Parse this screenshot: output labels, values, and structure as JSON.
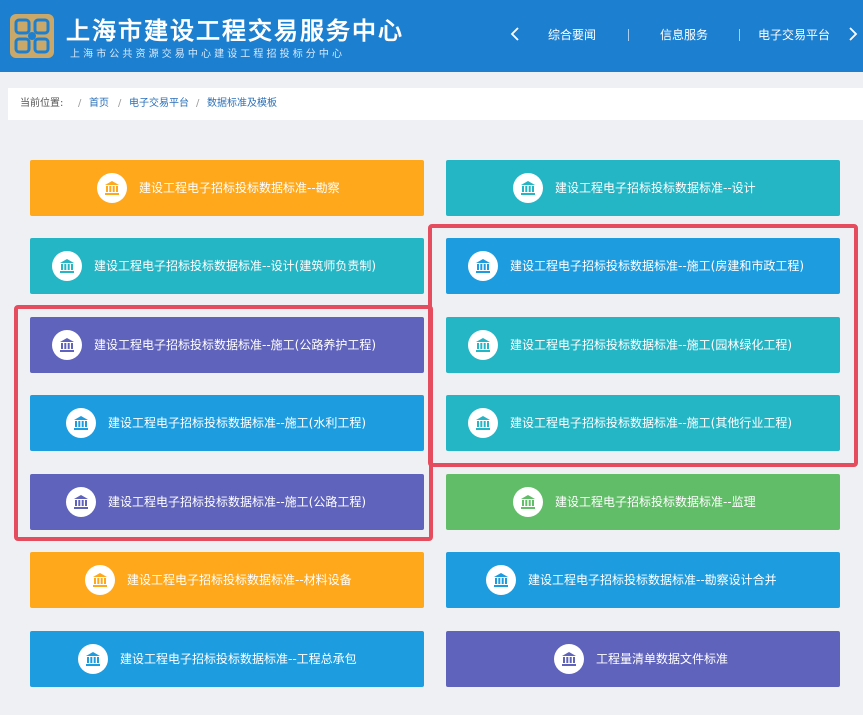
{
  "header": {
    "title": "上海市建设工程交易服务中心",
    "subtitle": "上海市公共资源交易中心建设工程招投标分中心",
    "prev_icon": "chevron-left-icon",
    "next_icon": "chevron-right-icon",
    "nav": [
      {
        "label": "综合要闻"
      },
      {
        "label": "信息服务"
      },
      {
        "label": "电子交易平台"
      }
    ]
  },
  "breadcrumb": {
    "label": "当前位置:",
    "separator": "/",
    "items": [
      {
        "label": "首页"
      },
      {
        "label": "电子交易平台"
      },
      {
        "label": "数据标准及模板"
      }
    ]
  },
  "colors": {
    "orange": "#ffa81c",
    "teal": "#25b6c6",
    "blue": "#1d9de0",
    "purple": "#6063bc",
    "green": "#62bd68",
    "highlight": "#e54c5d"
  },
  "tiles_icon": "bank-icon",
  "tiles": [
    {
      "label": "建设工程电子招标投标数据标准--勘察"
    },
    {
      "label": "建设工程电子招标投标数据标准--设计"
    },
    {
      "label": "建设工程电子招标投标数据标准--设计(建筑师负责制)"
    },
    {
      "label": "建设工程电子招标投标数据标准--施工(房建和市政工程)"
    },
    {
      "label": "建设工程电子招标投标数据标准--施工(公路养护工程)"
    },
    {
      "label": "建设工程电子招标投标数据标准--施工(园林绿化工程)"
    },
    {
      "label": "建设工程电子招标投标数据标准--施工(水利工程)"
    },
    {
      "label": "建设工程电子招标投标数据标准--施工(其他行业工程)"
    },
    {
      "label": "建设工程电子招标投标数据标准--施工(公路工程)"
    },
    {
      "label": "建设工程电子招标投标数据标准--监理"
    },
    {
      "label": "建设工程电子招标投标数据标准--材料设备"
    },
    {
      "label": "建设工程电子招标投标数据标准--勘察设计合并"
    },
    {
      "label": "建设工程电子招标投标数据标准--工程总承包"
    },
    {
      "label": "工程量清单数据文件标准"
    }
  ]
}
